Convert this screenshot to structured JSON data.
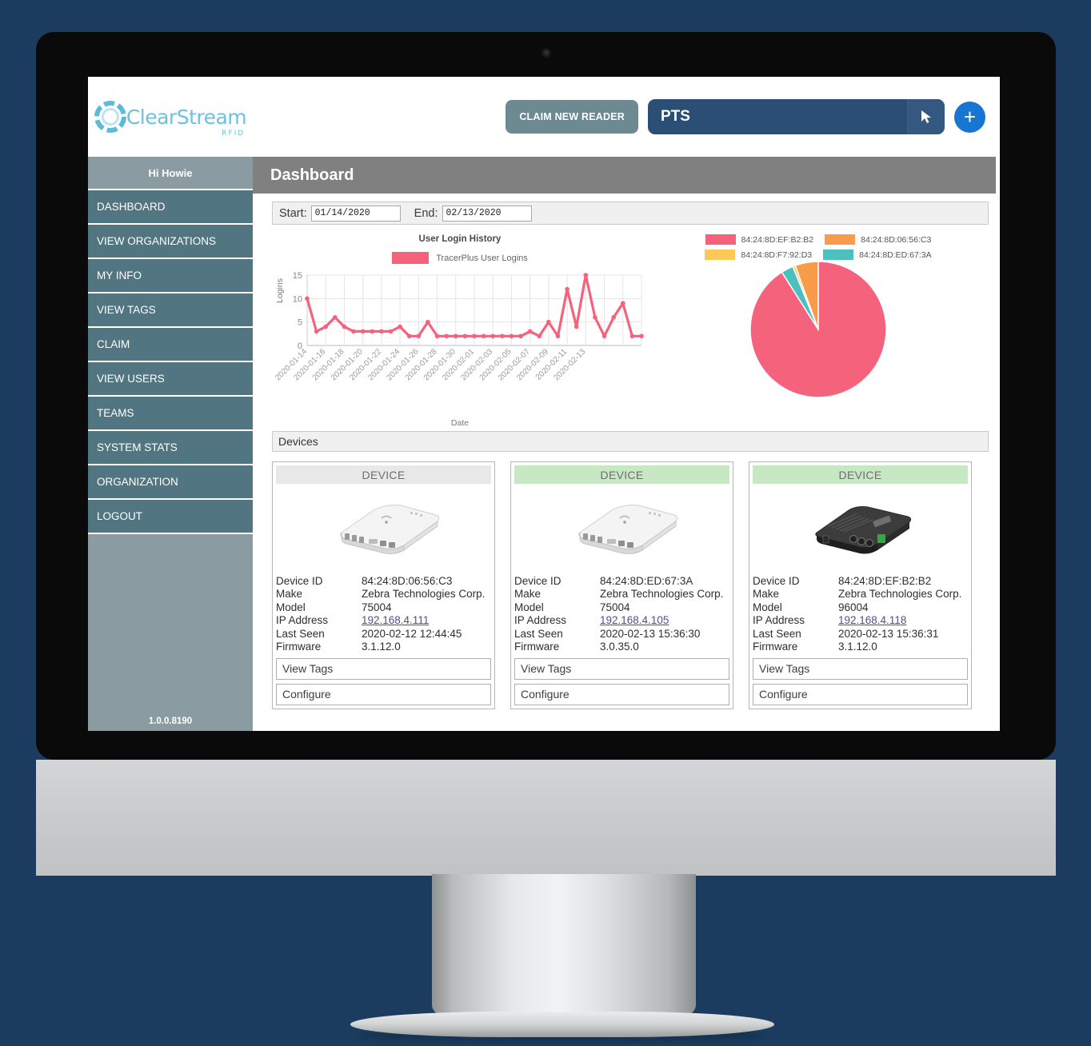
{
  "app": {
    "brand_name": "ClearStream",
    "brand_sub": "RFID",
    "version": "1.0.0.8190"
  },
  "sidebar": {
    "greeting": "Hi Howie",
    "items": [
      {
        "label": "DASHBOARD",
        "key": "dashboard"
      },
      {
        "label": "VIEW ORGANIZATIONS",
        "key": "view-organizations"
      },
      {
        "label": "MY INFO",
        "key": "my-info"
      },
      {
        "label": "VIEW TAGS",
        "key": "view-tags"
      },
      {
        "label": "CLAIM",
        "key": "claim"
      },
      {
        "label": "VIEW USERS",
        "key": "view-users"
      },
      {
        "label": "TEAMS",
        "key": "teams"
      },
      {
        "label": "SYSTEM STATS",
        "key": "system-stats"
      },
      {
        "label": "ORGANIZATION",
        "key": "organization"
      },
      {
        "label": "LOGOUT",
        "key": "logout"
      }
    ]
  },
  "topbar": {
    "claim_button": "CLAIM NEW READER",
    "org_selected": "PTS",
    "add_button": "+"
  },
  "page": {
    "title": "Dashboard"
  },
  "filters": {
    "start_label": "Start:",
    "start_value": "01/14/2020",
    "end_label": "End:",
    "end_value": "02/13/2020"
  },
  "devices_section": {
    "header": "Devices"
  },
  "colors": {
    "pink": "#f4627c",
    "orange": "#f89c4c",
    "yellow": "#fcc css",
    "yellow_hex": "#fcc956",
    "teal": "#4bc0be",
    "sidebar": "#517682",
    "accent_blue": "#1876d2",
    "org_select": "#2b4e74"
  },
  "chart_data": [
    {
      "type": "line",
      "title": "User Login History",
      "xlabel": "Date",
      "ylabel": "Logins",
      "ylim": [
        0,
        15
      ],
      "yticks": [
        0,
        5,
        10,
        15
      ],
      "grid": true,
      "legend_position": "top",
      "series": [
        {
          "name": "TracerPlus User Logins",
          "color": "#f4627c",
          "values": [
            10,
            3,
            4,
            6,
            4,
            3,
            3,
            3,
            3,
            3,
            4,
            2,
            2,
            5,
            2,
            2,
            2,
            2,
            2,
            2,
            2,
            2,
            2,
            2,
            3,
            2,
            5,
            2,
            12,
            4,
            15,
            6,
            2,
            6,
            9,
            2,
            2
          ]
        }
      ],
      "x": [
        "2020-01-14",
        "2020-01-15",
        "2020-01-16",
        "2020-01-17",
        "2020-01-18",
        "2020-01-19",
        "2020-01-20",
        "2020-01-21",
        "2020-01-22",
        "2020-01-23",
        "2020-01-24",
        "2020-01-25",
        "2020-01-26",
        "2020-01-27",
        "2020-01-28",
        "2020-01-29",
        "2020-01-30",
        "2020-01-31",
        "2020-02-01",
        "2020-02-02",
        "2020-02-03",
        "2020-02-04",
        "2020-02-05",
        "2020-02-06",
        "2020-02-07",
        "2020-02-08",
        "2020-02-09",
        "2020-02-10",
        "2020-02-11",
        "2020-02-12",
        "2020-02-13"
      ],
      "tick_labels": [
        "2020-01-14",
        "2020-01-16",
        "2020-01-18",
        "2020-01-20",
        "2020-01-22",
        "2020-01-24",
        "2020-01-26",
        "2020-01-28",
        "2020-01-30",
        "2020-02-01",
        "2020-02-03",
        "2020-02-05",
        "2020-02-07",
        "2020-02-09",
        "2020-02-11",
        "2020-02-13"
      ]
    },
    {
      "type": "pie",
      "title": "",
      "legend_position": "top",
      "labels": [
        "84:24:8D:EF:B2:B2",
        "84:24:8D:06:56:C3",
        "84:24:8D:F7:92:D3",
        "84:24:8D:ED:67:3A"
      ],
      "colors": [
        "#f4627c",
        "#f89c4c",
        "#fcc956",
        "#4bc0be"
      ],
      "values": [
        91,
        5.5,
        0.6,
        2.9
      ]
    }
  ],
  "devices": [
    {
      "header": "DEVICE",
      "status": "grey",
      "image": "rfid-reader-white",
      "fields": [
        {
          "key": "Device ID",
          "value": "84:24:8D:06:56:C3"
        },
        {
          "key": "Make",
          "value": "Zebra Technologies Corp."
        },
        {
          "key": "Model",
          "value": "75004"
        },
        {
          "key": "IP Address",
          "value": "192.168.4.111",
          "link": true
        },
        {
          "key": "Last Seen",
          "value": "2020-02-12 12:44:45"
        },
        {
          "key": "Firmware",
          "value": "3.1.12.0"
        }
      ],
      "buttons": [
        "View Tags",
        "Configure"
      ]
    },
    {
      "header": "DEVICE",
      "status": "green",
      "image": "rfid-reader-white",
      "fields": [
        {
          "key": "Device ID",
          "value": "84:24:8D:ED:67:3A"
        },
        {
          "key": "Make",
          "value": "Zebra Technologies Corp."
        },
        {
          "key": "Model",
          "value": "75004"
        },
        {
          "key": "IP Address",
          "value": "192.168.4.105",
          "link": true
        },
        {
          "key": "Last Seen",
          "value": "2020-02-13 15:36:30"
        },
        {
          "key": "Firmware",
          "value": "3.0.35.0"
        }
      ],
      "buttons": [
        "View Tags",
        "Configure"
      ]
    },
    {
      "header": "DEVICE",
      "status": "green",
      "image": "rfid-reader-black",
      "fields": [
        {
          "key": "Device ID",
          "value": "84:24:8D:EF:B2:B2"
        },
        {
          "key": "Make",
          "value": "Zebra Technologies Corp."
        },
        {
          "key": "Model",
          "value": "96004"
        },
        {
          "key": "IP Address",
          "value": "192.168.4.118",
          "link": true
        },
        {
          "key": "Last Seen",
          "value": "2020-02-13 15:36:31"
        },
        {
          "key": "Firmware",
          "value": "3.1.12.0"
        }
      ],
      "buttons": [
        "View Tags",
        "Configure"
      ]
    }
  ]
}
